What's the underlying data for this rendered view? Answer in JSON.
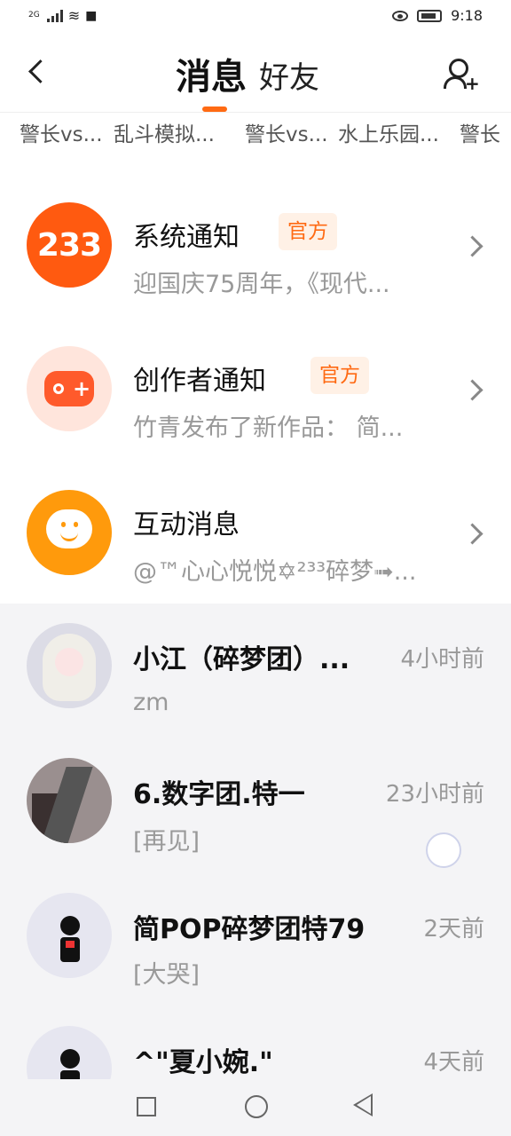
{
  "status_bar": {
    "network": "2G",
    "time": "9:18"
  },
  "header": {
    "tab_messages": "消息",
    "tab_friends": "好友"
  },
  "tags": [
    "警长vs...",
    "乱斗模拟...",
    "警长vs...",
    "水上乐园...",
    "警长"
  ],
  "official_items": [
    {
      "avatar_text": "233",
      "title": "系统通知",
      "badge": "官方",
      "subtitle": "迎国庆75周年，《现代..."
    },
    {
      "title": "创作者通知",
      "badge": "官方",
      "subtitle": "竹青发布了新作品：  简..."
    },
    {
      "title": "互动消息",
      "subtitle": "@™心心悦悦✡²³³碎梦➟..."
    }
  ],
  "conversations": [
    {
      "name": "小江（碎梦团）...",
      "time": "4小时前",
      "last_message": "zm"
    },
    {
      "name": "6.数字团.特一",
      "time": "23小时前",
      "last_message": "[再见]"
    },
    {
      "name": "简POP碎梦团特79",
      "time": "2天前",
      "last_message": "[大哭]"
    },
    {
      "name": "^\"夏小婉.\"",
      "time": "4天前",
      "last_message": ""
    }
  ],
  "colors": {
    "accent": "#ff6a13",
    "badge_bg": "#fff1e6",
    "system_logo": "#ff5a10",
    "interact_logo": "#ff9a0c",
    "list_bg": "#f4f4f6"
  }
}
